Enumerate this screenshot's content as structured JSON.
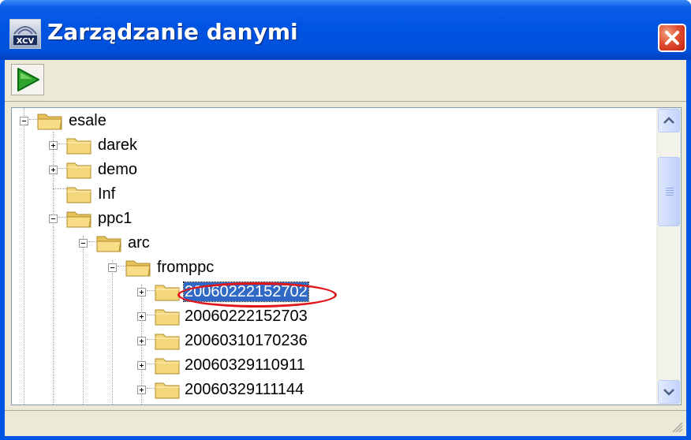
{
  "window": {
    "title": "Zarządzanie danymi",
    "app_icon": "xcv-app-icon",
    "close_icon": "close-icon"
  },
  "toolbar": {
    "run_icon": "play-icon"
  },
  "tree": {
    "root": "esale",
    "items": [
      {
        "label": "esale",
        "expander": "minus",
        "level": 0
      },
      {
        "label": "darek",
        "expander": "plus",
        "level": 1
      },
      {
        "label": "demo",
        "expander": "plus",
        "level": 1
      },
      {
        "label": "Inf",
        "expander": "none",
        "level": 1
      },
      {
        "label": "ppc1",
        "expander": "minus",
        "level": 1
      },
      {
        "label": "arc",
        "expander": "minus",
        "level": 2
      },
      {
        "label": "fromppc",
        "expander": "minus",
        "level": 3
      },
      {
        "label": "20060222152702",
        "expander": "plus",
        "level": 4,
        "selected": true
      },
      {
        "label": "20060222152703",
        "expander": "plus",
        "level": 4
      },
      {
        "label": "20060310170236",
        "expander": "plus",
        "level": 4
      },
      {
        "label": "20060329110911",
        "expander": "plus",
        "level": 4
      },
      {
        "label": "20060329111144",
        "expander": "plus",
        "level": 4
      }
    ]
  },
  "colors": {
    "selection": "#316ac5",
    "annotation": "#e0161a",
    "folder": "#f5d77b"
  }
}
